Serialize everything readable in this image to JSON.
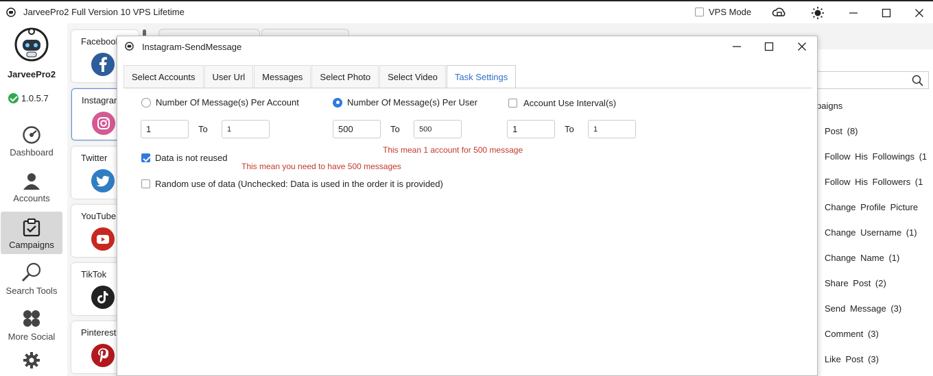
{
  "window": {
    "title": "JarveePro2 Full Version 10 VPS Lifetime",
    "vps_mode_label": "VPS Mode"
  },
  "sidebar": {
    "brand": "JarveePro2",
    "version": "1.0.5.7",
    "items": [
      {
        "label": "Dashboard",
        "icon": "dashboard-icon"
      },
      {
        "label": "Accounts",
        "icon": "accounts-icon"
      },
      {
        "label": "Campaigns",
        "icon": "campaigns-icon",
        "active": true
      },
      {
        "label": "Search Tools",
        "icon": "search-tools-icon"
      },
      {
        "label": "More Social",
        "icon": "more-social-icon"
      },
      {
        "label": "",
        "icon": "settings-gear-icon"
      }
    ]
  },
  "social": [
    {
      "label": "Facebook",
      "icon": "facebook-icon",
      "color": "#2d5d9b"
    },
    {
      "label": "Instagram",
      "icon": "instagram-icon",
      "color": "#d35a93",
      "active": true
    },
    {
      "label": "Twitter",
      "icon": "twitter-icon",
      "color": "#2f7dc2"
    },
    {
      "label": "YouTube",
      "icon": "youtube-icon",
      "color": "#c8281f"
    },
    {
      "label": "TikTok",
      "icon": "tiktok-icon",
      "color": "#222222"
    },
    {
      "label": "Pinterest",
      "icon": "pinterest-icon",
      "color": "#b1191f"
    }
  ],
  "campaigns_panel": {
    "heading": "paigns",
    "items": [
      "Post (8)",
      "Follow His Followings (1",
      "Follow His Followers (1",
      "Change Profile Picture",
      "Change Username (1)",
      "Change Name (1)",
      "Share Post (2)",
      "Send Message (3)",
      "Comment (3)",
      "Like Post (3)"
    ]
  },
  "dialog": {
    "title": "Instagram-SendMessage",
    "tabs": [
      "Select Accounts",
      "User Url",
      "Messages",
      "Select Photo",
      "Select Video",
      "Task Settings"
    ],
    "active_tab": "Task Settings",
    "per_account": {
      "label": "Number Of Message(s) Per Account",
      "from": "1",
      "to": "1",
      "to_label": "To"
    },
    "per_user": {
      "label": "Number Of Message(s) Per User",
      "from": "500",
      "to": "500",
      "to_label": "To"
    },
    "interval": {
      "label": "Account Use Interval(s)",
      "from": "1",
      "to": "1",
      "to_label": "To"
    },
    "not_reused_label": "Data is not reused",
    "random_label": "Random use of data (Unchecked: Data is used in the order it is provided)",
    "note_account": "This mean 1 account for 500 message",
    "note_messages": "This mean you need to have 500 messages"
  },
  "colors": {
    "accent": "#2f7be0",
    "note": "#c0392b",
    "tab_active": "#2f6fc9"
  }
}
